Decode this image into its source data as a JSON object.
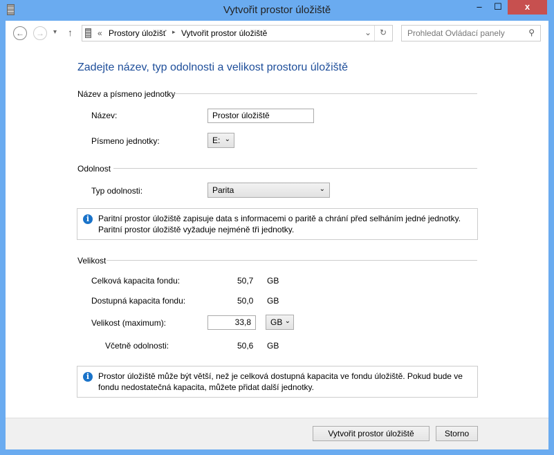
{
  "window": {
    "title": "Vytvořit prostor úložiště",
    "minimize": "‒",
    "maximize": "☐",
    "close": "x"
  },
  "nav": {
    "back": "←",
    "forward": "→",
    "recent": "▾",
    "up": "↑",
    "breadcrumb_sep": "«",
    "crumbs": [
      "Prostory úložišť",
      "Vytvořit prostor úložiště"
    ],
    "crumb_arrow": "▸",
    "dropdown": "⌄",
    "refresh": "↻",
    "search_placeholder": "Prohledat Ovládací panely",
    "search_icon": "⚲"
  },
  "main": {
    "heading": "Zadejte název, typ odolnosti a velikost prostoru úložiště",
    "drive_section": {
      "title": "Název a písmeno jednotky",
      "name_label": "Název:",
      "name_value": "Prostor úložiště",
      "letter_label": "Písmeno jednotky:",
      "letter_value": "E:"
    },
    "resiliency_section": {
      "title": "Odolnost",
      "type_label": "Typ odolnosti:",
      "type_value": "Parita",
      "info_line1": "Paritní prostor úložiště zapisuje data s informacemi o paritě a chrání před selháním jedné jednotky.",
      "info_line2": "Paritní prostor úložiště vyžaduje nejméně tři jednotky."
    },
    "size_section": {
      "title": "Velikost",
      "total_label": "Celková kapacita fondu:",
      "total_value": "50,7",
      "total_unit": "GB",
      "available_label": "Dostupná kapacita fondu:",
      "available_value": "50,0",
      "available_unit": "GB",
      "size_label": "Velikost (maximum):",
      "size_value": "33,8",
      "size_unit": "GB",
      "incl_label": "Včetně odolnosti:",
      "incl_value": "50,6",
      "incl_unit": "GB",
      "info_line1": "Prostor úložiště může být větší, než je celková dostupná kapacita ve fondu úložiště. Pokud bude ve",
      "info_line2": "fondu nedostatečná kapacita, můžete přidat další jednotky."
    }
  },
  "footer": {
    "create": "Vytvořit prostor úložiště",
    "cancel": "Storno"
  }
}
